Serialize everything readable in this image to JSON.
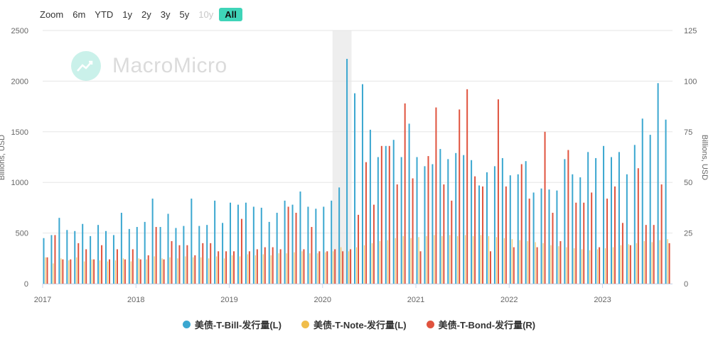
{
  "zoom": {
    "label": "Zoom",
    "options": [
      "6m",
      "YTD",
      "1y",
      "2y",
      "3y",
      "5y",
      "10y",
      "All"
    ],
    "disabled": [
      "10y"
    ],
    "active": "All"
  },
  "watermark": {
    "text": "MacroMicro"
  },
  "colors": {
    "bill": "#3ba7d0",
    "note": "#f0bd4a",
    "bond": "#e0533e",
    "highlight": "#eeeeee",
    "grid": "#e6e6e6"
  },
  "chart_data": {
    "type": "bar",
    "highlight_period": [
      "2020-02",
      "2020-04"
    ],
    "x_ticks": [
      "2017",
      "2018",
      "2019",
      "2020",
      "2021",
      "2022",
      "2023"
    ],
    "x_range": [
      "2017-01",
      "2023-09"
    ],
    "y_left": {
      "label": "Billions, USD",
      "range": [
        0,
        2500
      ],
      "ticks": [
        "0",
        "500",
        "1000",
        "1500",
        "2000",
        "2500"
      ]
    },
    "y_right": {
      "label": "Billions, USD",
      "range": [
        0,
        125
      ],
      "ticks": [
        "0",
        "25",
        "50",
        "75",
        "100",
        "125"
      ]
    },
    "legend_position": "bottom",
    "grid": true,
    "series": [
      {
        "name": "美债-T-Bill-发行量(L)",
        "axis": "left",
        "values": [
          450,
          480,
          650,
          530,
          520,
          590,
          470,
          580,
          520,
          480,
          700,
          540,
          560,
          610,
          840,
          560,
          690,
          550,
          570,
          840,
          570,
          580,
          820,
          600,
          800,
          780,
          800,
          760,
          750,
          610,
          700,
          820,
          780,
          910,
          760,
          740,
          760,
          820,
          950,
          2220,
          1880,
          1970,
          1520,
          1250,
          1360,
          1420,
          1250,
          1580,
          1250,
          1160,
          1180,
          1330,
          1230,
          1290,
          1270,
          1220,
          970,
          1100,
          1160,
          1240,
          1070,
          1080,
          1210,
          900,
          940,
          930,
          920,
          1230,
          1080,
          1050,
          1300,
          1240,
          1360,
          1250,
          1300,
          1080,
          1370,
          1630,
          1470,
          1980,
          1620
        ]
      },
      {
        "name": "美债-T-Note-发行量(L)",
        "axis": "left",
        "values": [
          260,
          200,
          250,
          230,
          260,
          220,
          240,
          230,
          220,
          230,
          250,
          220,
          250,
          240,
          270,
          250,
          260,
          250,
          270,
          260,
          260,
          250,
          270,
          250,
          280,
          270,
          290,
          280,
          290,
          280,
          300,
          300,
          310,
          320,
          300,
          300,
          310,
          320,
          360,
          320,
          360,
          380,
          400,
          420,
          430,
          450,
          470,
          450,
          460,
          470,
          480,
          470,
          480,
          470,
          480,
          470,
          480,
          470,
          460,
          450,
          440,
          430,
          420,
          410,
          400,
          380,
          370,
          360,
          350,
          340,
          330,
          340,
          350,
          360,
          380,
          390,
          400,
          420,
          410,
          430,
          440
        ]
      },
      {
        "name": "美债-T-Bond-发行量(R)",
        "axis": "right",
        "values": [
          13,
          24,
          12,
          12,
          20,
          17,
          12,
          19,
          12,
          17,
          12,
          17,
          12,
          14,
          28,
          12,
          21,
          19,
          19,
          14,
          20,
          20,
          16,
          16,
          16,
          32,
          16,
          17,
          18,
          18,
          17,
          38,
          35,
          17,
          28,
          16,
          16,
          17,
          16,
          17,
          34,
          60,
          39,
          68,
          68,
          49,
          89,
          52,
          16,
          63,
          87,
          49,
          41,
          86,
          96,
          53,
          48,
          16,
          91,
          48,
          18,
          59,
          42,
          18,
          75,
          35,
          21,
          66,
          40,
          40,
          45,
          18,
          42,
          48,
          30,
          19,
          57,
          29,
          29,
          49,
          20
        ]
      }
    ]
  }
}
